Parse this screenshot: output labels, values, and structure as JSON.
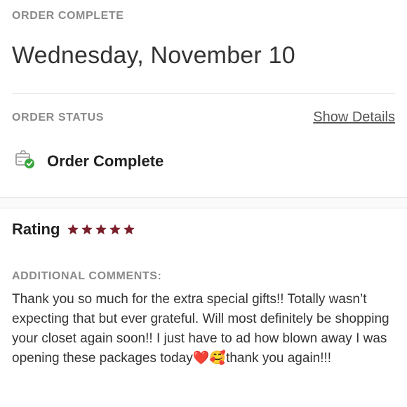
{
  "order": {
    "heading": "ORDER COMPLETE",
    "date": "Wednesday, November 10"
  },
  "status": {
    "heading": "ORDER STATUS",
    "show_details": "Show Details",
    "status_text": "Order Complete",
    "icon": "box-check-icon"
  },
  "rating": {
    "label": "Rating",
    "stars": 5,
    "max_stars": 5,
    "star_color": "#7a1f2b"
  },
  "comments": {
    "heading": "ADDITIONAL COMMENTS:",
    "text": "Thank you so much for the extra special gifts!! Totally wasn’t expecting that but ever grateful. Will most definitely be shopping your closet again soon!! I just have to ad how blown away I was opening these packages today❤️🥰thank you again!!!"
  },
  "colors": {
    "accent_green": "#3aa63f",
    "star": "#7a1f2b"
  }
}
